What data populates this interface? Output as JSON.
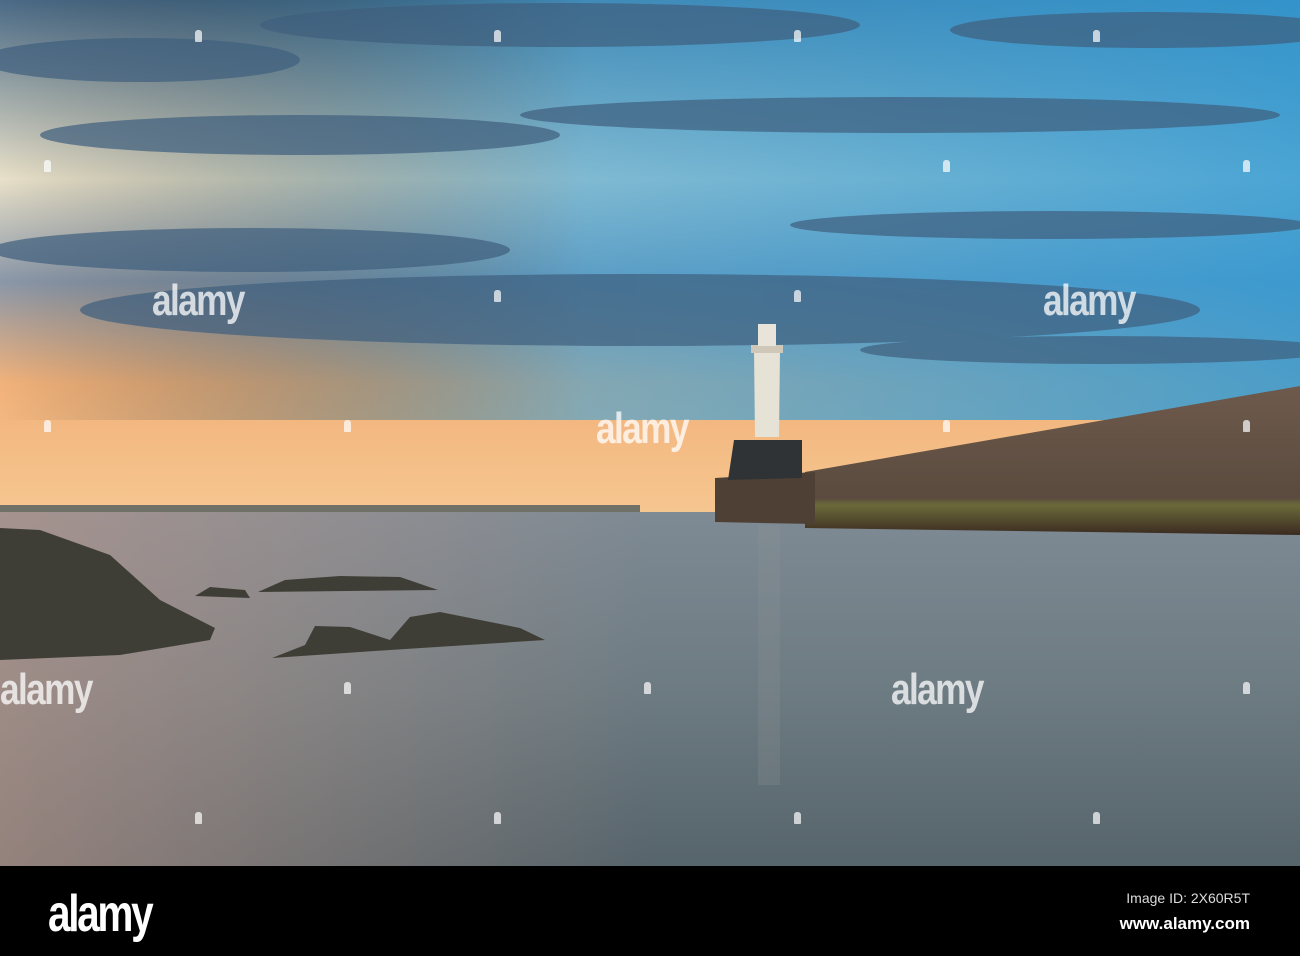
{
  "watermark": "alamy",
  "footer": {
    "logo": "alamy",
    "image_id": "Image ID: 2X60R5T",
    "url": "www.alamy.com"
  },
  "colors": {
    "sky_top": "#4f7c9c",
    "sky_glow": "#f4e0b0",
    "sunset": "#f0b07a",
    "water": "#6f7f86"
  }
}
